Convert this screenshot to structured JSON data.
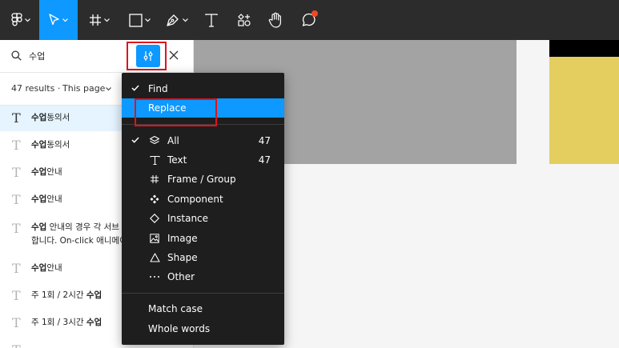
{
  "toolbar": {
    "icons": [
      "figma-logo-icon",
      "move-tool-icon",
      "frame-tool-icon",
      "shape-tool-icon",
      "pen-tool-icon",
      "text-tool-icon",
      "resources-icon",
      "hand-tool-icon",
      "comment-icon"
    ],
    "active_tool": "move-tool-icon"
  },
  "search": {
    "value": "수업"
  },
  "results": {
    "count_label": "47 results",
    "separator": "·",
    "scope_label": "This page"
  },
  "result_items": [
    {
      "text_bold": "수업",
      "text_rest": "동의서"
    },
    {
      "text_bold": "수업",
      "text_rest": "동의서"
    },
    {
      "text_bold": "수업",
      "text_rest": "안내"
    },
    {
      "text_bold": "수업",
      "text_rest": "안내"
    },
    {
      "text_bold": "수업",
      "text_rest": " 안내의 경우 각 서브 페",
      "line2": "합니다. On-click 애니메이"
    },
    {
      "text_bold": "수업",
      "text_rest": "안내"
    },
    {
      "text_pre": "주 1회 / 2시간 ",
      "text_bold": "수업"
    },
    {
      "text_pre": "주 1회 / 3시간 ",
      "text_bold": "수업"
    }
  ],
  "menu": {
    "find": "Find",
    "replace": "Replace",
    "types": [
      {
        "label": "All",
        "count": "47",
        "icon": "layers-icon",
        "checked": true
      },
      {
        "label": "Text",
        "count": "47",
        "icon": "text-icon"
      },
      {
        "label": "Frame / Group",
        "count": "",
        "icon": "frame-icon"
      },
      {
        "label": "Component",
        "count": "",
        "icon": "component-icon"
      },
      {
        "label": "Instance",
        "count": "",
        "icon": "instance-icon"
      },
      {
        "label": "Image",
        "count": "",
        "icon": "image-icon"
      },
      {
        "label": "Shape",
        "count": "",
        "icon": "shape-icon"
      },
      {
        "label": "Other",
        "count": "",
        "icon": "more-icon"
      }
    ],
    "match_case": "Match case",
    "whole_words": "Whole words"
  },
  "colors": {
    "accent": "#0d99ff",
    "toolbar_bg": "#2c2c2c",
    "menu_bg": "#1e1e1e",
    "highlight_box": "#e0131e",
    "canvas_yellow": "#e4ce60"
  }
}
